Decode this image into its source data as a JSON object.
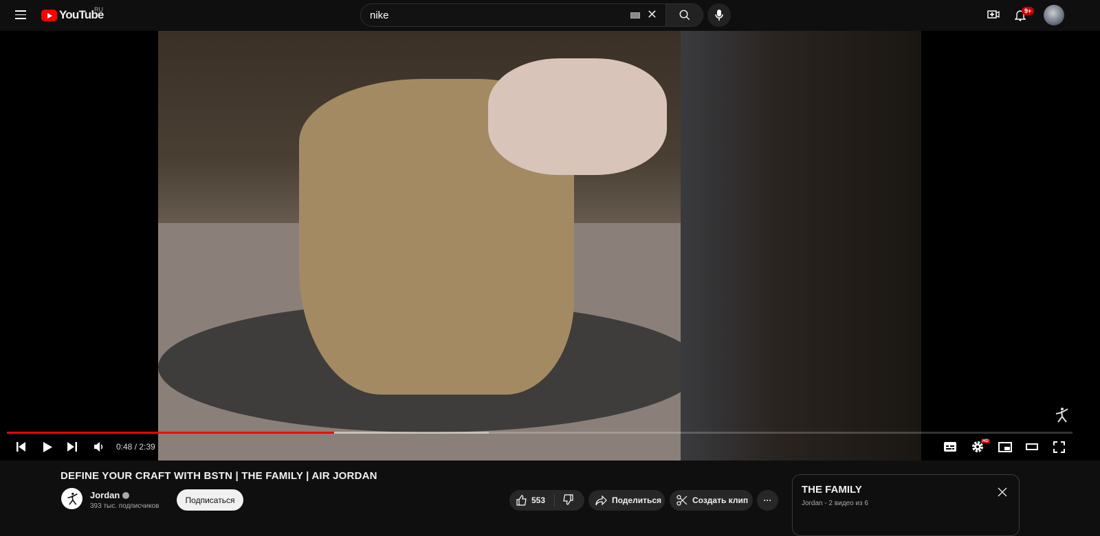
{
  "header": {
    "logo": "YouTube",
    "region": "RU",
    "search_value": "nike",
    "notifications_badge": "9+"
  },
  "player": {
    "current_time": "0:48",
    "duration": "2:39",
    "time_display": "0:48 / 2:39",
    "played_fraction": 0.307,
    "buffered_fraction": 0.452,
    "settings_badge": "HD"
  },
  "video": {
    "title": "DEFINE YOUR CRAFT WITH BSTN | THE FAMILY | AIR JORDAN"
  },
  "channel": {
    "name": "Jordan",
    "subscribers": "393 тыс. подписчиков",
    "subscribe_label": "Подписаться"
  },
  "actions": {
    "likes": "553",
    "share": "Поделиться",
    "clip": "Создать клип",
    "more": "···"
  },
  "playlist": {
    "title": "THE FAMILY",
    "subtitle": "Jordan - 2 видео из 6"
  },
  "colors": {
    "accent": "#ff0000",
    "background": "#0f0f0f"
  }
}
